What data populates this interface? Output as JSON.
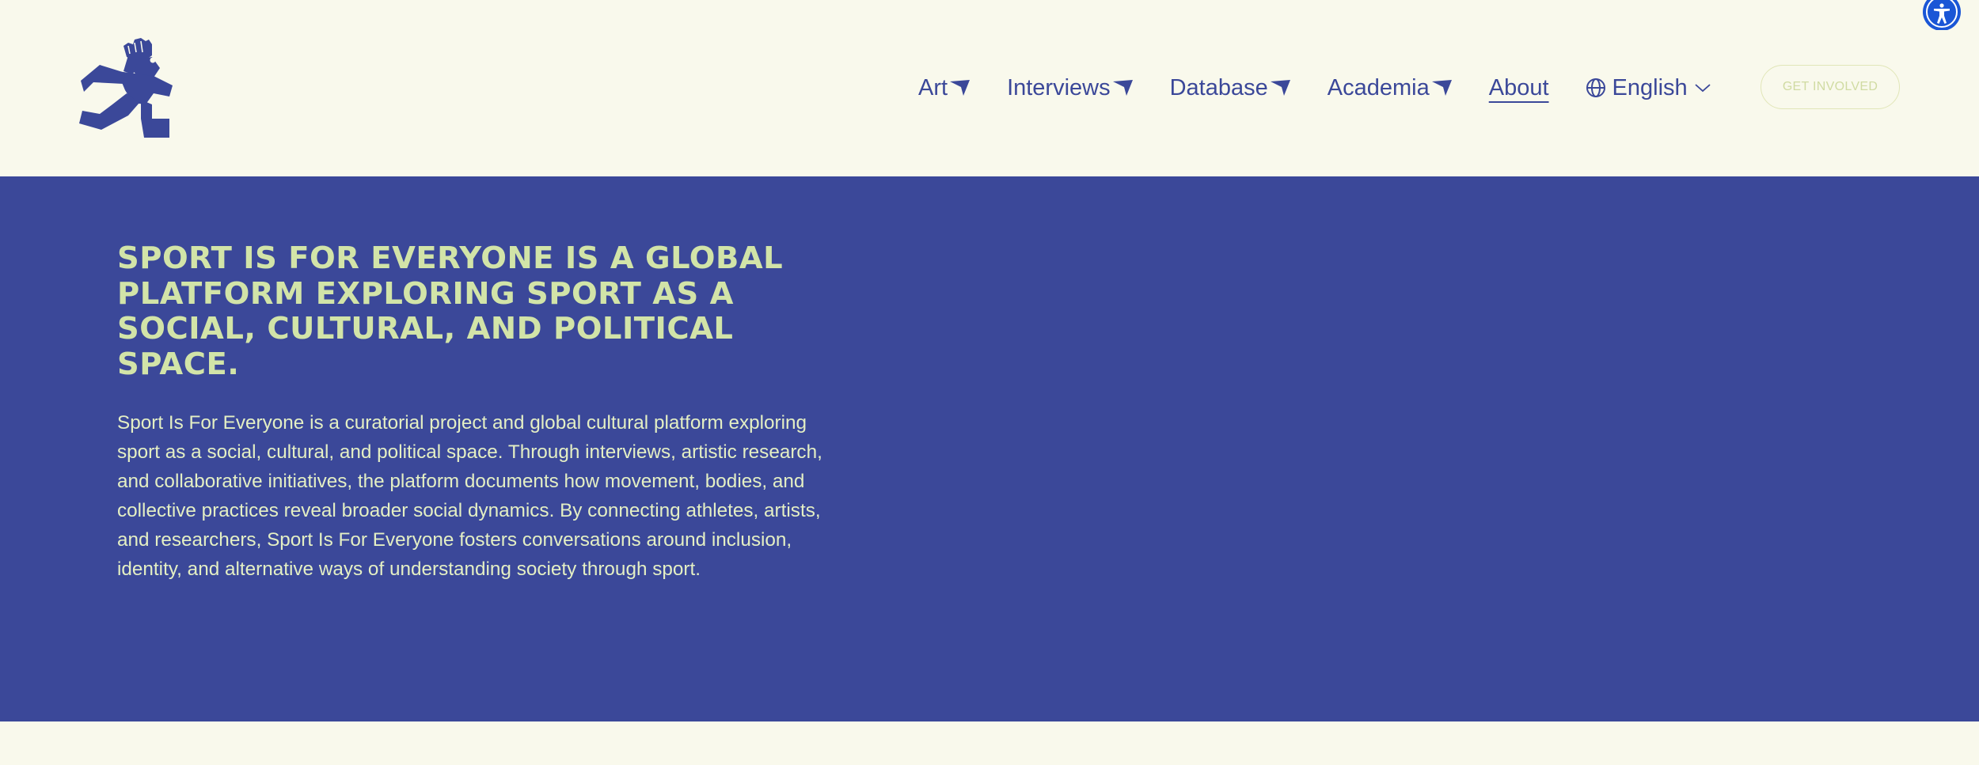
{
  "brand": {
    "logo_icon": "running-figure-raised-fist-logo",
    "colors": {
      "primary": "#3b4899",
      "accent": "#d2e4a8",
      "background": "#f9f9ec"
    }
  },
  "nav": {
    "items": [
      {
        "label": "Art",
        "has_dropdown": true
      },
      {
        "label": "Interviews",
        "has_dropdown": true
      },
      {
        "label": "Database",
        "has_dropdown": true
      },
      {
        "label": "Academia",
        "has_dropdown": true
      },
      {
        "label": "About",
        "has_dropdown": false,
        "active": true
      }
    ],
    "language": {
      "label": "English",
      "icon": "globe-icon"
    },
    "cta_label": "GET INVOLVED"
  },
  "accessibility": {
    "icon": "accessibility-icon",
    "color": "#1a56d6"
  },
  "hero": {
    "title": "SPORT IS FOR EVERYONE IS A GLOBAL PLATFORM EXPLORING SPORT AS A SOCIAL, CULTURAL, AND POLITICAL SPACE.",
    "body": "Sport Is For Everyone is a curatorial project and global cultural platform exploring sport as a social, cultural, and political space. Through interviews, artistic research, and collaborative initiatives, the platform documents how movement, bodies, and collective practices reveal broader social dynamics. By connecting athletes, artists, and researchers, Sport Is For Everyone fosters conversations around inclusion, identity, and alternative ways of understanding society through sport."
  }
}
